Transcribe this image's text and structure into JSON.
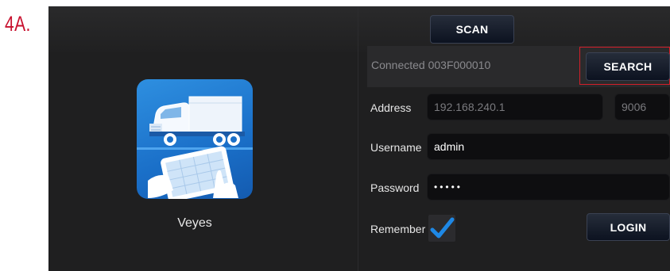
{
  "step_label": "4A.",
  "app": {
    "name": "Veyes",
    "icon": "truck-tablet-app-icon"
  },
  "toolbar": {
    "scan_label": "SCAN"
  },
  "connection": {
    "status_text": "Connected 003F000010",
    "search_label": "SEARCH"
  },
  "form": {
    "address_label": "Address",
    "address_value": "192.168.240.1",
    "port_value": "9006",
    "username_label": "Username",
    "username_value": "admin",
    "password_label": "Password",
    "password_value": "•••••",
    "remember_label": "Remember",
    "remember_checked": true,
    "login_label": "LOGIN"
  },
  "colors": {
    "accent_red": "#c8102e",
    "highlight_frame": "#d31f2a",
    "check_blue": "#1e88e5",
    "background": "#1f1f20"
  }
}
